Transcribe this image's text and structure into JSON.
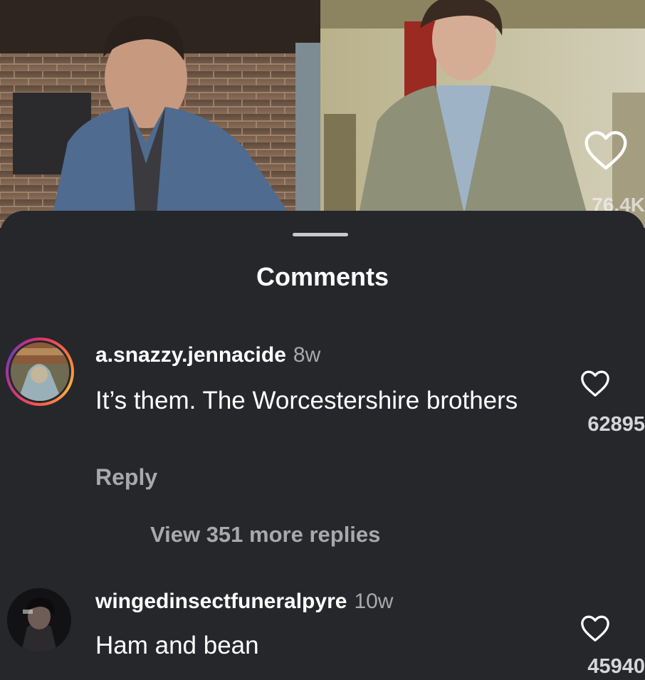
{
  "video": {
    "like_count": "76.4K",
    "like_icon": "heart-outline-icon"
  },
  "sheet": {
    "title": "Comments"
  },
  "comments": [
    {
      "username": "a.snazzy.jennacide",
      "time": "8w",
      "text": "It’s them. The Worcestershire brothers",
      "reply_label": "Reply",
      "view_replies": "View 351 more replies",
      "like_count": "62895",
      "has_story_ring": true
    },
    {
      "username": "wingedinsectfuneralpyre",
      "time": "10w",
      "text": "Ham and bean",
      "like_count": "45940",
      "has_story_ring": false
    }
  ],
  "colors": {
    "background": "#26272b",
    "primary_text": "#ffffff",
    "secondary_text": "#a8a8ad"
  }
}
